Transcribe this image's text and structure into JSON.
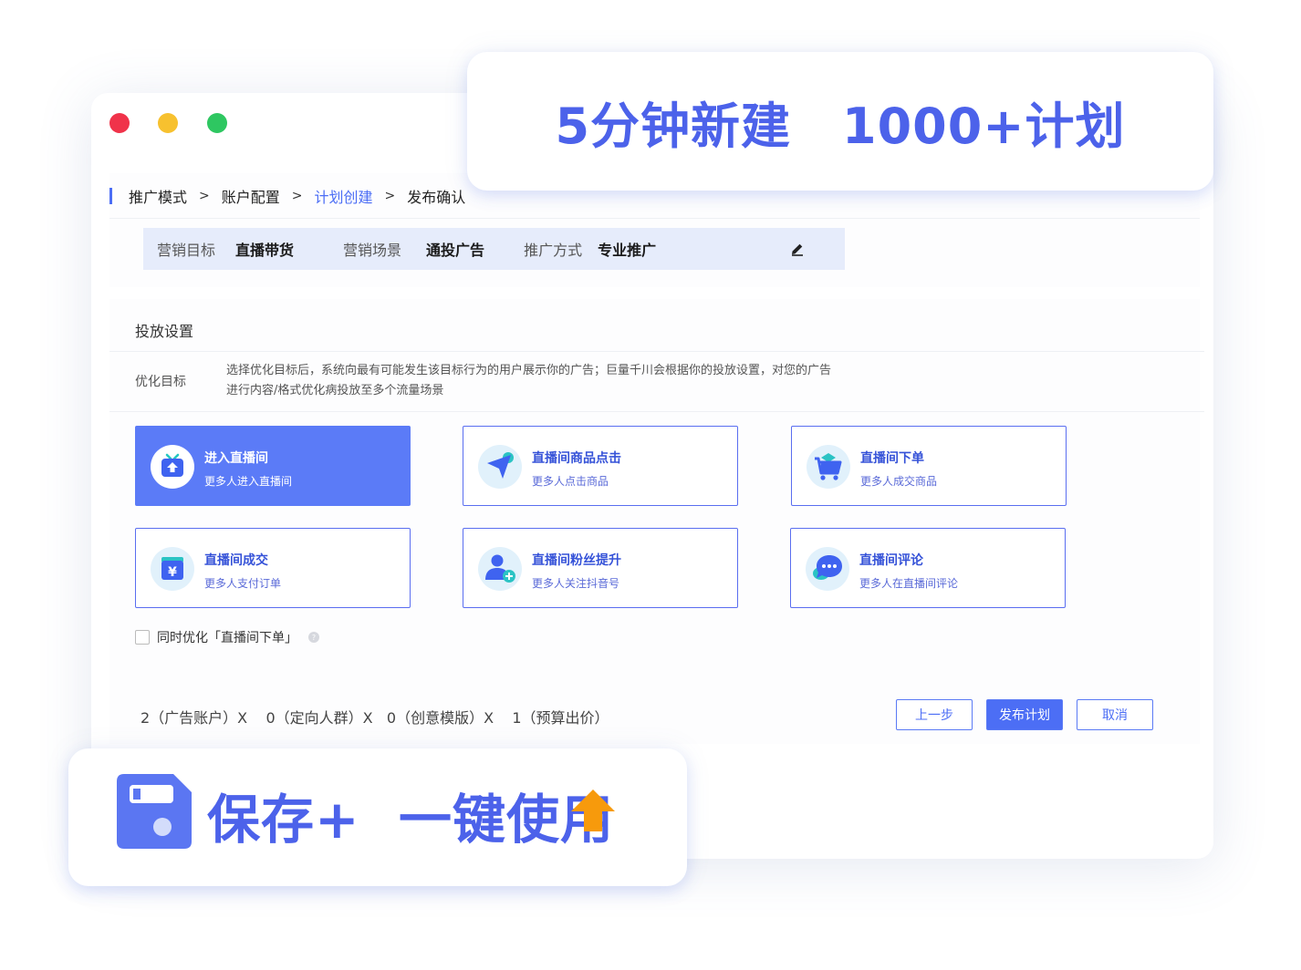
{
  "headline": {
    "part1": "5分钟新建",
    "part2": "1000+计划"
  },
  "breadcrumb": {
    "items": [
      "推广模式",
      "账户配置",
      "计划创建",
      "发布确认"
    ],
    "separator": ">",
    "active_index": 2
  },
  "summary": {
    "goal_label": "营销目标",
    "goal_value": "直播带货",
    "scene_label": "营销场景",
    "scene_value": "通投广告",
    "method_label": "推广方式",
    "method_value": "专业推广"
  },
  "placement": {
    "section_title": "投放设置",
    "opt_label": "优化目标",
    "opt_desc": "选择优化目标后，系统向最有可能发生该目标行为的用户展示你的广告；巨量千川会根据你的投放设置，对您的广告进行内容/格式优化病投放至多个流量场景"
  },
  "cards": [
    {
      "title": "进入直播间",
      "sub": "更多人进入直播间",
      "icon": "tv-up-icon",
      "selected": true
    },
    {
      "title": "直播间商品点击",
      "sub": "更多人点击商品",
      "icon": "cursor-click-icon",
      "selected": false
    },
    {
      "title": "直播间下单",
      "sub": "更多人成交商品",
      "icon": "shopping-cart-icon",
      "selected": false
    },
    {
      "title": "直播间成交",
      "sub": "更多人支付订单",
      "icon": "yuan-payment-icon",
      "selected": false
    },
    {
      "title": "直播间粉丝提升",
      "sub": "更多人关注抖音号",
      "icon": "add-user-icon",
      "selected": false
    },
    {
      "title": "直播间评论",
      "sub": "更多人在直播间评论",
      "icon": "chat-bubble-icon",
      "selected": false
    }
  ],
  "also_optimize": {
    "label": "同时优化「直播间下单」",
    "checked": false
  },
  "formula": {
    "text": "2（广告账户）X    0（定向人群）X   0（创意模版）X    1（预算出价）"
  },
  "buttons": {
    "prev": "上一步",
    "publish": "发布计划",
    "cancel": "取消"
  },
  "save_banner": {
    "text": "保存+  一键使用"
  },
  "colors": {
    "accent": "#4c6ef5",
    "headline": "#4c62ea",
    "arrow": "#f79a0c",
    "dot_red": "#f0334a",
    "dot_yellow": "#f7c12f",
    "dot_green": "#2ec761"
  }
}
